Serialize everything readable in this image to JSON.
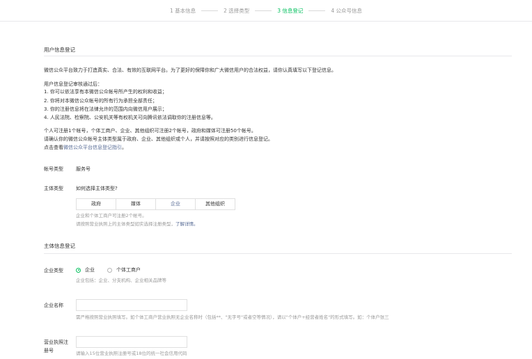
{
  "steps": [
    {
      "label": "1 基本信息",
      "active": false
    },
    {
      "label": "2 选择类型",
      "active": false
    },
    {
      "label": "3 信息登记",
      "active": true
    },
    {
      "label": "4 公众号信息",
      "active": false
    }
  ],
  "user_section": {
    "title": "用户信息登记",
    "intro": "微信公众平台致力于打造真实、合法、有效的互联网平台。为了更好的保障你和广大微信用户的合法权益，请你认真填写以下登记信息。",
    "audit_title": "用户信息登记审核通过后：",
    "audit_items": [
      "1. 你可以依法享有本微信公众帐号所产生的权利和收益；",
      "2. 你将对本微信公众帐号的所有行为承担全部责任；",
      "3. 你的注册信息将在法律允许的范围内向微信用户展示；",
      "4. 人民法院、检察院、公安机关等有权机关可向腾讯依法调取你的注册信息等。"
    ],
    "limit_text": "个人可注册1个帐号，个体工商户、企业、其他组织可注册2个帐号，政府和媒体可注册50个帐号。",
    "confirm_text": "请确认你的微信公众帐号主体类型属于政府、企业、其他组织或个人，并请按照对应的类别进行信息登记。",
    "guide_prefix": "点击查看",
    "guide_link": "微信公众平台信息登记指引",
    "guide_suffix": "。"
  },
  "account_type": {
    "label": "帐号类型",
    "value": "服务号"
  },
  "subject_type": {
    "label": "主体类型",
    "help_link": "如何选择主体类型?",
    "options": [
      "政府",
      "媒体",
      "企业",
      "其他组织"
    ],
    "selected": "企业",
    "hint1": "企业和个体工商户可注册2个帐号。",
    "hint2_prefix": "请按照营业执照上的主体类型如实选择注册类型，",
    "hint2_link": "了解详情。"
  },
  "subject_section": {
    "title": "主体信息登记"
  },
  "enterprise_type": {
    "label": "企业类型",
    "options": [
      "企业",
      "个体工商户"
    ],
    "selected": "企业",
    "hint": "企业包括：企业、分支机构、企业相关品牌等"
  },
  "enterprise_name": {
    "label": "企业名称",
    "value": "",
    "placeholder": "",
    "hint": "需严格按照营业执照填写。如个体工商户营业执照无企业名称时（包括**、\"无字号\"或者空等情况），请以\"个体户+经营者姓名\"的形式填写。如：个体户张三"
  },
  "license_no": {
    "label_line1": "营业执照注",
    "label_line2": "册号",
    "value": "",
    "hint": "请输入15位营业执照注册号或18位的统一社会信用代码"
  }
}
